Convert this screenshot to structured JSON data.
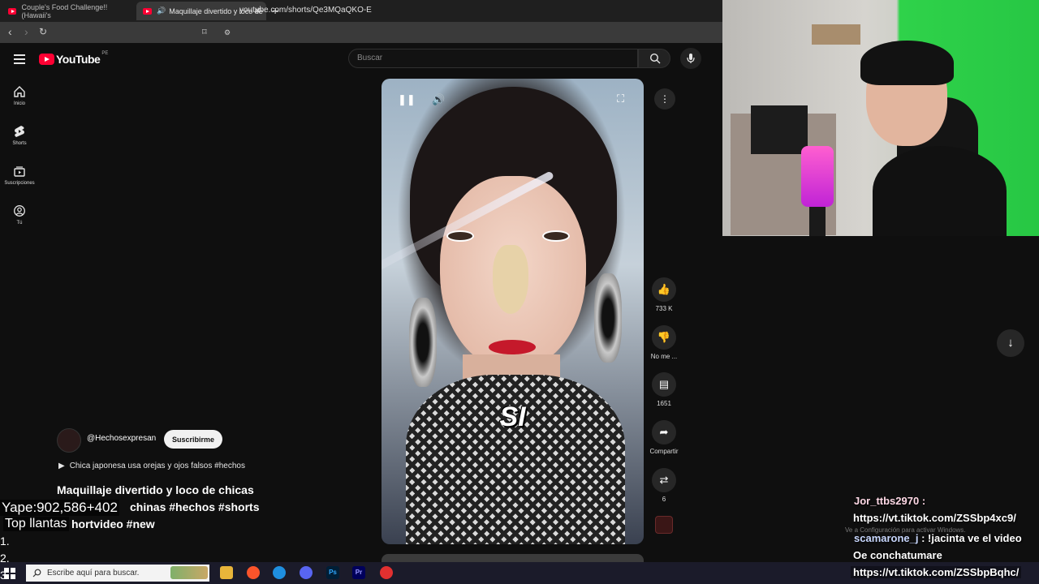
{
  "browser": {
    "tabs": [
      {
        "label": "Couple's Food Challenge!! (Hawaii's"
      },
      {
        "label": "Maquillaje divertido y loco de"
      }
    ],
    "url": "youtube.com/shorts/Qe3MQaQKO-E"
  },
  "youtube": {
    "logo_text": "YouTube",
    "region": "PE",
    "search_placeholder": "Buscar",
    "sidebar": [
      {
        "label": "Inicio",
        "icon": "home-icon"
      },
      {
        "label": "Shorts",
        "icon": "shorts-icon"
      },
      {
        "label": "Suscripciones",
        "icon": "subscriptions-icon"
      },
      {
        "label": "Tú",
        "icon": "you-icon"
      }
    ],
    "video": {
      "caption": "SI",
      "channel": "@Hechosexpresan",
      "subscribe_label": "Suscribirme",
      "playlist_text": "Chica japonesa usa orejas y ojos falsos #hechos",
      "title_lines": [
        "Maquillaje divertido y loco de chicas",
        "chinas #hechos #shorts",
        "hortvideo #new"
      ]
    },
    "actions": {
      "likes": "733 K",
      "dislike_label": "No me ...",
      "comments": "1651",
      "share_label": "Compartir",
      "remix_count": "6"
    }
  },
  "overlay": {
    "yape": "Yape:902,586+402",
    "top_llantas": "Top llantas",
    "numbers": [
      "1.",
      "2.",
      "3."
    ]
  },
  "chat": {
    "user1": "Jor_ttbs2970 :",
    "msg1": "https://vt.tiktok.com/ZSSbp4xc9/",
    "user2": "scamarone_j",
    "msg2": " : !jacinta ve el video",
    "msg3": "Oe conchatumare",
    "msg4": "https://vt.tiktok.com/ZSSbpBqhc/",
    "activate_note": "Ve a Configuración para activar Windows."
  },
  "taskbar": {
    "search_placeholder": "Escribe aquí para buscar."
  },
  "colors": {
    "youtube_red": "#ff0033",
    "background": "#0f0f0f"
  }
}
